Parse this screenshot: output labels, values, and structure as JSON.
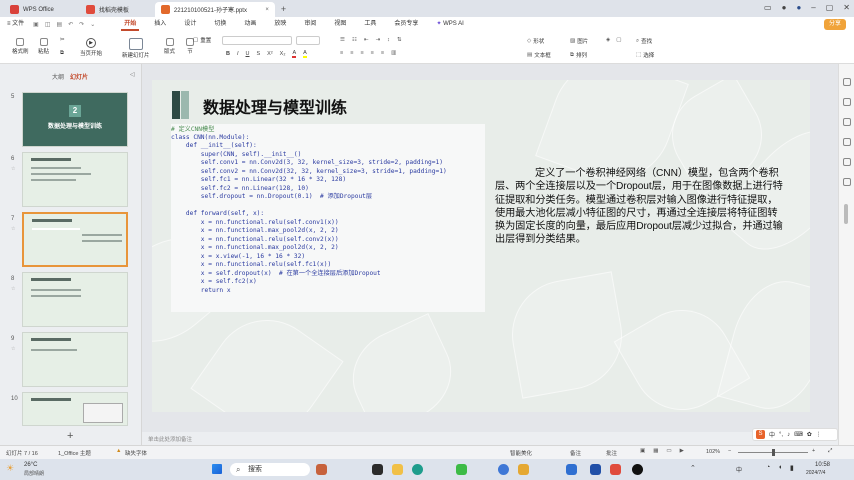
{
  "tabs": [
    {
      "label": "WPS Office",
      "color": "#d9413a"
    },
    {
      "label": "找稻壳模板",
      "color": "#e04b3c"
    },
    {
      "label": "221210100521-孙子寒.pptx",
      "color": "#e2692b"
    }
  ],
  "menu": {
    "file": "≡ 文件",
    "items": [
      "开始",
      "插入",
      "设计",
      "切换",
      "动画",
      "放映",
      "审阅",
      "视图",
      "工具",
      "会员专享"
    ],
    "ai": "WPS AI",
    "share": "分享"
  },
  "ribbon": {
    "format_painter": "格式刷",
    "paste": "粘贴",
    "play": "当页开始",
    "new_slide": "新建幻灯片",
    "layout": "版式",
    "section": "节",
    "reset": "重置",
    "shape": "形状",
    "picture": "图片",
    "textbox": "文本框",
    "arrange": "排列",
    "find": "查找",
    "select": "选择"
  },
  "left_panel": {
    "tab_outline": "大纲",
    "tab_slides": "幻灯片",
    "thumbs": [
      {
        "num": "5",
        "title": "数据处理与模型训练",
        "badge": "2"
      },
      {
        "num": "6"
      },
      {
        "num": "7"
      },
      {
        "num": "8"
      },
      {
        "num": "9"
      },
      {
        "num": "10"
      }
    ],
    "add": "+"
  },
  "slide": {
    "title": "数据处理与模型训练",
    "code": [
      "# 定义CNN模型",
      "class CNN(nn.Module):",
      "    def __init__(self):",
      "        super(CNN, self).__init__()",
      "        self.conv1 = nn.Conv2d(3, 32, kernel_size=3, stride=2, padding=1)",
      "        self.conv2 = nn.Conv2d(32, 32, kernel_size=3, stride=1, padding=1)",
      "        self.fc1 = nn.Linear(32 * 16 * 32, 128)",
      "        self.fc2 = nn.Linear(128, 10)",
      "        self.dropout = nn.Dropout(0.1)  # 添加Dropout层",
      "",
      "    def forward(self, x):",
      "        x = nn.functional.relu(self.conv1(x))",
      "        x = nn.functional.max_pool2d(x, 2, 2)",
      "        x = nn.functional.relu(self.conv2(x))",
      "        x = nn.functional.max_pool2d(x, 2, 2)",
      "        x = x.view(-1, 16 * 16 * 32)",
      "        x = nn.functional.relu(self.fc1(x))",
      "        x = self.dropout(x)  # 在第一个全连接层后添加Dropout",
      "        x = self.fc2(x)",
      "        return x"
    ],
    "description": "定义了一个卷积神经网络（CNN）模型，包含两个卷积层、两个全连接层以及一个Dropout层，用于在图像数据上进行特征提取和分类任务。模型通过卷积层对输入图像进行特征提取，使用最大池化层减小特征图的尺寸，再通过全连接层将特征图转换为固定长度的向量，最后应用Dropout层减少过拟合，并通过输出层得到分类结果。"
  },
  "notes_placeholder": "单击此处添加备注",
  "status": {
    "slide_info": "幻灯片 7 / 16",
    "theme": "1_Office 主题",
    "font_missing": "缺失字体",
    "smart_beautify": "智能美化",
    "notes": "备注",
    "comments": "批注",
    "zoom": "102%"
  },
  "ime": {
    "label": "中"
  },
  "taskbar": {
    "weather_temp": "26°C",
    "weather_desc": "局部晴朗",
    "search": "搜索",
    "lang": "中",
    "time": "10:58",
    "date": "2024/7/4"
  }
}
